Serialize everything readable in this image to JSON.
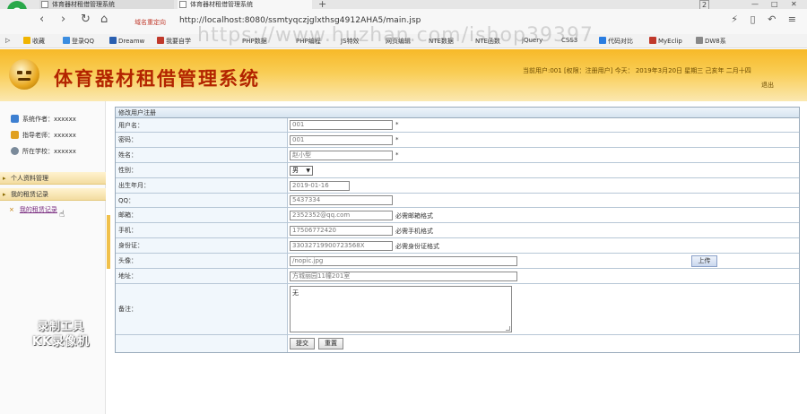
{
  "browser": {
    "tabs": [
      {
        "label": "体育器材租借管理系统"
      },
      {
        "label": "体育器材租借管理系统"
      }
    ],
    "new_tab": "+",
    "tab_count": "2",
    "window_controls": {
      "minimize": "—",
      "maximize": "□",
      "close": "✕"
    },
    "domain_indicator": "域名重定向",
    "url": "http://localhost:8080/ssmtyqczjglxthsg4912AHA5/main.jsp",
    "bookmarks": [
      {
        "label": "收藏"
      },
      {
        "label": "登录QQ"
      },
      {
        "label": "Dreamw"
      },
      {
        "label": "我要自学"
      },
      {
        "label": "PHP数据"
      },
      {
        "label": "PHP编程"
      },
      {
        "label": "JS特效"
      },
      {
        "label": "网页编辑"
      },
      {
        "label": "NTE数据"
      },
      {
        "label": "NTE函数"
      },
      {
        "label": "jQuery"
      },
      {
        "label": "CSS3"
      },
      {
        "label": "代码对比"
      },
      {
        "label": "MyEclip"
      },
      {
        "label": "DW8系"
      }
    ],
    "watermark": "https://www.huzhan.com/ishop39397"
  },
  "header": {
    "title": "体育器材租借管理系统",
    "user_info": "当前用户:001 [权限：注册用户] 今天：  2019年3月20日 星期三 己亥年 二月十四",
    "logout": "退出"
  },
  "sidebar": {
    "info": [
      {
        "label": "系统作者：xxxxxx"
      },
      {
        "label": "指导老师：xxxxxx"
      },
      {
        "label": "所在学校：xxxxxx"
      }
    ],
    "menu": [
      {
        "label": "个人资料管理"
      },
      {
        "label": "我的租赁记录",
        "items": [
          {
            "label": "我的租赁记录"
          }
        ]
      }
    ],
    "recorder_mark": {
      "line1": "录制工具",
      "line2": "KK录像机"
    }
  },
  "form": {
    "title": "修改用户注册",
    "fields": {
      "username": {
        "label": "用户名：",
        "value": "001",
        "required": "*"
      },
      "password": {
        "label": "密码：",
        "value": "001",
        "required": "*"
      },
      "name": {
        "label": "姓名：",
        "value": "赵小型",
        "required": "*"
      },
      "gender": {
        "label": "性别：",
        "value": "男",
        "caret": "▼"
      },
      "birthday": {
        "label": "出生年月：",
        "value": "2019-01-16"
      },
      "qq": {
        "label": "QQ：",
        "value": "5437334"
      },
      "email": {
        "label": "邮箱：",
        "value": "2352352@qq.com",
        "hint": "必需邮箱格式"
      },
      "phone": {
        "label": "手机：",
        "value": "17506772420",
        "hint": "必需手机格式"
      },
      "idcard": {
        "label": "身份证：",
        "value": "330327199007235​68X",
        "hint": "必需身份证格式"
      },
      "avatar": {
        "label": "头像：",
        "value": "/nopic.jpg",
        "button": "上传"
      },
      "address": {
        "label": "地址：",
        "value": "方城丽园11幢201室"
      },
      "remark": {
        "label": "备注：",
        "value": "无"
      }
    },
    "submit": "提交",
    "reset": "重置"
  }
}
